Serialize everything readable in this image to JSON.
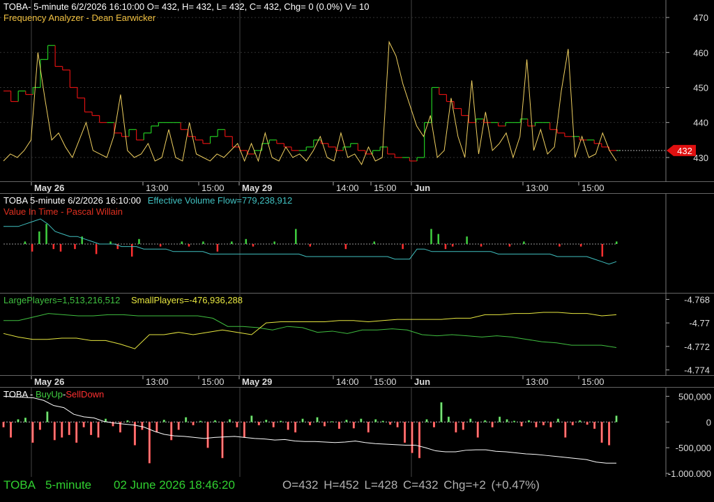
{
  "price_pane": {
    "line1": "TOBA- 5-minute 6/2/2026 16:10:00 O= 432, H= 432, L= 432, C= 432, Chg= 0 (0.0%) V= 10",
    "line2": "Frequency Analyzer - Dean Earwicker",
    "current_price_badge": "432",
    "colors": {
      "up": "#22cc22",
      "down": "#dd1111",
      "oscillator": "#f0d060",
      "badge": "#e01010"
    }
  },
  "time_axis_labels": [
    "May 26",
    "13:00",
    "15:00",
    "May 29",
    "14:00",
    "15:00",
    "Jun",
    "13:00",
    "15:00"
  ],
  "evf_pane": {
    "title": "TOBA 5-minute  6/2/2026 16:10:00",
    "evf_label": "Effective Volume Flow=779,238,912",
    "subtitle": "Value In Time - Pascal Willain",
    "colors": {
      "title": "#ffffff",
      "evf": "#40c0c0",
      "subtitle": "#e03020"
    }
  },
  "players_pane": {
    "large_label": "LargePlayers=1,513,216,512",
    "small_label": "SmallPlayers=-476,936,288",
    "colors": {
      "large": "#40c040",
      "small": "#e8e840"
    }
  },
  "buy_pane": {
    "ticker": "TOBA - ",
    "buy_label": "BuyUp",
    "dash": "-",
    "sell_label": "SellDown",
    "colors": {
      "buy": "#40d040",
      "sell": "#ff3030"
    }
  },
  "status_bar": {
    "symbol": "TOBA",
    "interval": "5-minute",
    "datetime": "02 June 2026 18:46:20",
    "ohlc": "O=432  H=452  L=428  C=432  Chg=+2 (+0.47%)"
  },
  "chart_data": [
    {
      "type": "line",
      "name_text": "Frequency Analyzer - Dean Earwicker",
      "ylim": [
        424,
        474
      ],
      "yticks": [
        430,
        440,
        450,
        460,
        470
      ],
      "last_value": 432,
      "price_steps": [
        449,
        446,
        449,
        448,
        450,
        458,
        462,
        456,
        455,
        450,
        447,
        443,
        442,
        440,
        440,
        437,
        436,
        438,
        435,
        437,
        439,
        440,
        440,
        440,
        438,
        436,
        435,
        434,
        436,
        438,
        436,
        433,
        432,
        431,
        432,
        434,
        435,
        434,
        433,
        432,
        432,
        433,
        435,
        434,
        433,
        432,
        433,
        434,
        432,
        431,
        432,
        433,
        431,
        430,
        430,
        429,
        430,
        440,
        450,
        448,
        446,
        444,
        442,
        440,
        441,
        440,
        440,
        439,
        440,
        440,
        441,
        439,
        440,
        440,
        438,
        437,
        436,
        436,
        435,
        435,
        434,
        433,
        432,
        432
      ],
      "oscillator": [
        429,
        431,
        430,
        432,
        435,
        460,
        447,
        435,
        437,
        433,
        430,
        435,
        440,
        432,
        431,
        430,
        436,
        448,
        432,
        430,
        431,
        434,
        429,
        430,
        438,
        430,
        429,
        440,
        431,
        430,
        429,
        431,
        430,
        432,
        434,
        429,
        434,
        429,
        437,
        430,
        429,
        433,
        430,
        431,
        429,
        432,
        436,
        430,
        429,
        437,
        430,
        431,
        428,
        433,
        429,
        430,
        463,
        459,
        451,
        445,
        439,
        436,
        442,
        430,
        432,
        447,
        436,
        430,
        452,
        431,
        443,
        432,
        434,
        437,
        430,
        436,
        458,
        432,
        438,
        431,
        433,
        449,
        461,
        430,
        436,
        430,
        431,
        437,
        432,
        429
      ]
    },
    {
      "type": "bar",
      "name_text": "Effective Volume Flow",
      "evf_bars": [
        0,
        0,
        0,
        1,
        -3,
        5,
        8,
        -2,
        -3,
        0,
        -2,
        3,
        0,
        -4,
        0,
        1,
        -2,
        0,
        -5,
        2,
        0,
        0,
        -1,
        0,
        0,
        1,
        -1,
        0,
        1,
        0,
        -3,
        0,
        1,
        0,
        2,
        -1,
        0,
        0,
        1,
        0,
        0,
        6,
        0,
        -1,
        0,
        0,
        0,
        0,
        -2,
        0,
        0,
        0,
        1,
        0,
        0,
        0,
        -2,
        0,
        0,
        0,
        6,
        4,
        -2,
        -1,
        0,
        3,
        0,
        -1,
        0,
        0,
        0,
        -1,
        0,
        1,
        0,
        0,
        0,
        0,
        -1,
        0,
        0,
        -1,
        0,
        0,
        -5,
        0,
        1
      ],
      "evf_line": [
        7,
        7,
        7,
        8,
        9,
        10,
        8,
        5,
        4,
        3,
        3,
        2,
        1,
        0,
        0,
        0,
        -1,
        -1,
        -1,
        -2,
        -2,
        -2,
        -2,
        -3,
        -3,
        -3,
        -3,
        -3,
        -4,
        -4,
        -4,
        -4,
        -4,
        -4,
        -4,
        -4,
        -4,
        -4,
        -4,
        -4,
        -4,
        -5,
        -5,
        -5,
        -5,
        -5,
        -5,
        -5,
        -5,
        -5,
        -5,
        -5,
        -5,
        -6,
        -6,
        -6,
        -2,
        -2,
        -3,
        -3,
        -3,
        -3,
        -3,
        -3,
        -3,
        -3,
        -3,
        -4,
        -4,
        -4,
        -4,
        -4,
        -4,
        -4,
        -4,
        -5,
        -5,
        -5,
        -5,
        -5,
        -6,
        -7,
        -8,
        -7
      ]
    },
    {
      "type": "line",
      "name_text": "LargePlayers / SmallPlayers",
      "ylim": [
        -4.7745,
        -4.7675
      ],
      "yticks": [
        -4.768,
        -4.77,
        -4.772,
        -4.774
      ],
      "ytick_labels": [
        "-4.768",
        "-4.77",
        "-4.772",
        "-4.774"
      ],
      "series": [
        {
          "name": "LargePlayers",
          "values": [
            -4.7698,
            -4.7698,
            -4.7695,
            -4.7692,
            -4.7693,
            -4.7694,
            -4.7694,
            -4.7693,
            -4.7693,
            -4.7694,
            -4.7694,
            -4.7694,
            -4.7694,
            -4.7694,
            -4.7696,
            -4.7703,
            -4.7703,
            -4.7704,
            -4.7706,
            -4.7703,
            -4.7704,
            -4.7708,
            -4.7707,
            -4.7709,
            -4.7706,
            -4.7706,
            -4.7705,
            -4.7706,
            -4.771,
            -4.7711,
            -4.771,
            -4.7711,
            -4.7712,
            -4.7711,
            -4.7712,
            -4.7714,
            -4.7716,
            -4.7717,
            -4.7719,
            -4.7719,
            -4.7719,
            -4.7721
          ]
        },
        {
          "name": "SmallPlayers",
          "values": [
            -4.7709,
            -4.7712,
            -4.7714,
            -4.7714,
            -4.7713,
            -4.7713,
            -4.7715,
            -4.7715,
            -4.7718,
            -4.7722,
            -4.771,
            -4.771,
            -4.7708,
            -4.771,
            -4.7708,
            -4.7706,
            -4.7708,
            -4.771,
            -4.77,
            -4.7699,
            -4.7699,
            -4.7699,
            -4.7699,
            -4.7698,
            -4.7698,
            -4.7699,
            -4.7698,
            -4.7697,
            -4.7697,
            -4.7697,
            -4.7697,
            -4.7696,
            -4.7696,
            -4.7693,
            -4.7693,
            -4.7692,
            -4.7692,
            -4.7691,
            -4.7691,
            -4.7692,
            -4.7692,
            -4.7694,
            -4.7693
          ]
        }
      ]
    },
    {
      "type": "bar",
      "name_text": "BuyUp-SellDown",
      "ylim": [
        -1000000,
        600000
      ],
      "yticks": [
        500000,
        0,
        -500000,
        -1000000
      ],
      "ytick_labels": [
        "500,000",
        "0",
        "-500,000",
        "-1,000,000"
      ],
      "bars": [
        -100000,
        -300000,
        50000,
        80000,
        -400000,
        -150000,
        200000,
        -350000,
        -300000,
        -250000,
        -400000,
        -100000,
        -250000,
        -300000,
        60000,
        -80000,
        -200000,
        30000,
        -450000,
        -150000,
        -800000,
        -200000,
        40000,
        -350000,
        -150000,
        90000,
        -60000,
        20000,
        -500000,
        30000,
        -700000,
        50000,
        -100000,
        -300000,
        120000,
        -60000,
        40000,
        -100000,
        20000,
        -150000,
        -200000,
        60000,
        -60000,
        90000,
        -80000,
        10000,
        -130000,
        40000,
        -120000,
        60000,
        -200000,
        50000,
        20000,
        -50000,
        -100000,
        -400000,
        -600000,
        -700000,
        50000,
        -100000,
        380000,
        100000,
        -200000,
        -150000,
        60000,
        -300000,
        30000,
        -100000,
        100000,
        50000,
        20000,
        -80000,
        30000,
        -100000,
        -60000,
        -100000,
        60000,
        -300000,
        -60000,
        30000,
        -50000,
        -130000,
        -400000,
        -450000,
        120000
      ],
      "line": [
        500000,
        490000,
        480000,
        470000,
        420000,
        320000,
        280000,
        150000,
        100000,
        80000,
        10000,
        -20000,
        -40000,
        -60000,
        -100000,
        -180000,
        -240000,
        -270000,
        -280000,
        -300000,
        -320000,
        -300000,
        -290000,
        -280000,
        -300000,
        -320000,
        -330000,
        -350000,
        -340000,
        -370000,
        -380000,
        -380000,
        -390000,
        -400000,
        -390000,
        -370000,
        -400000,
        -420000,
        -430000,
        -440000,
        -450000,
        -450000,
        -500000,
        -560000,
        -580000,
        -580000,
        -550000,
        -540000,
        -540000,
        -570000,
        -580000,
        -600000,
        -620000,
        -630000,
        -650000,
        -670000,
        -690000,
        -710000,
        -730000,
        -780000,
        -800000,
        -800000
      ]
    }
  ]
}
